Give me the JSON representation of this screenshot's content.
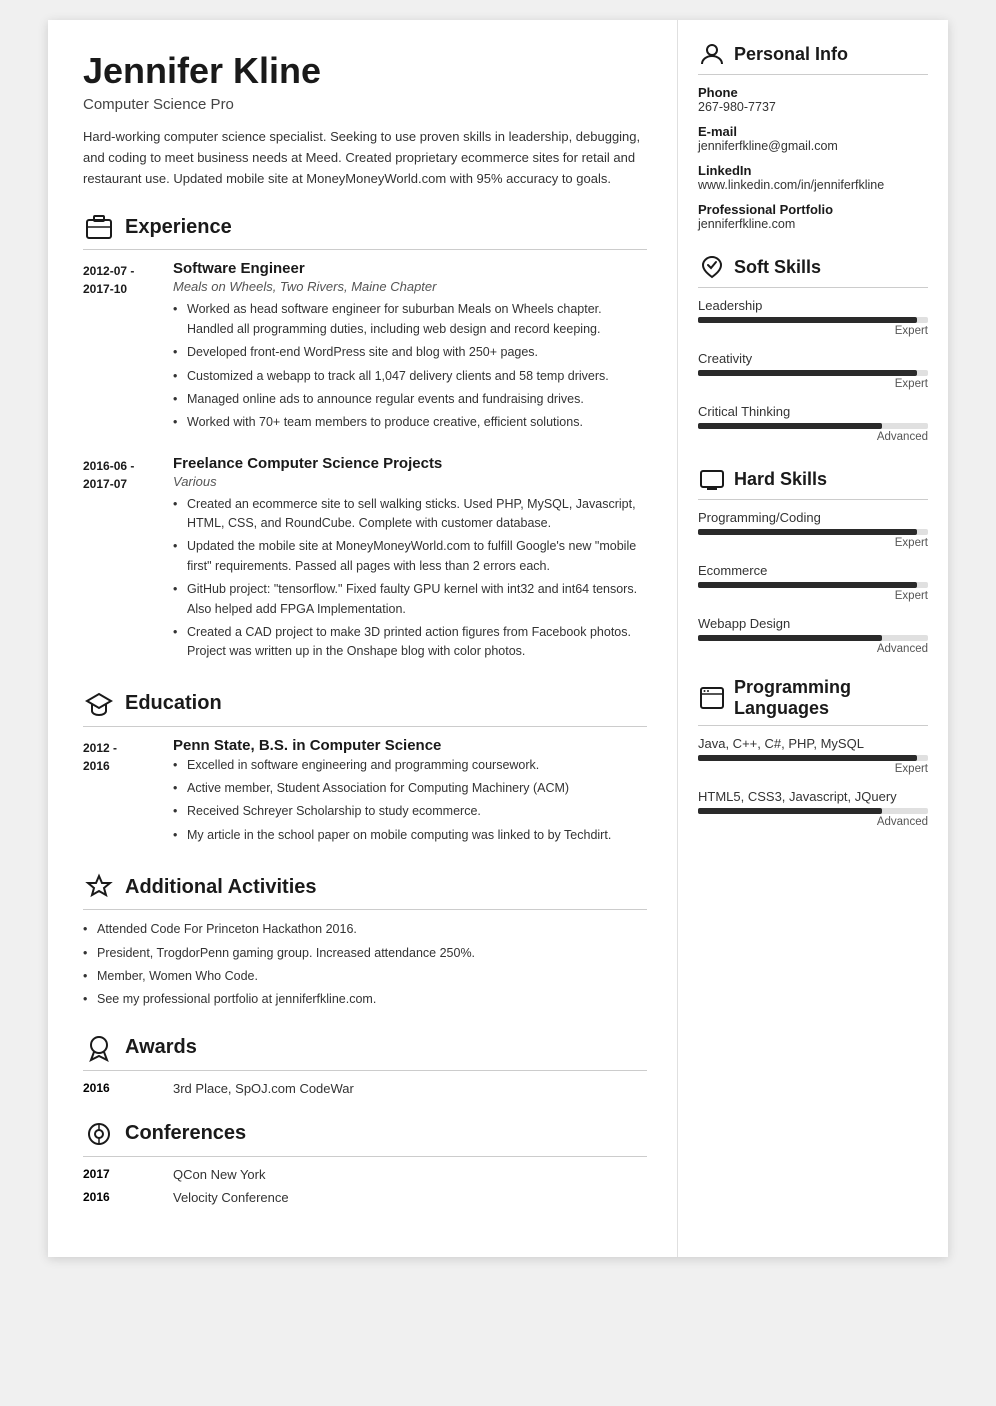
{
  "header": {
    "name": "Jennifer Kline",
    "title": "Computer Science Pro",
    "summary": "Hard-working computer science specialist. Seeking to use proven skills in leadership, debugging, and coding to meet business needs at Meed. Created proprietary ecommerce sites for retail and restaurant use. Updated mobile site at MoneyMoneyWorld.com with 95% accuracy to goals."
  },
  "sections": {
    "experience": {
      "title": "Experience",
      "entries": [
        {
          "date": "2012-07 -\n2017-10",
          "job_title": "Software Engineer",
          "company": "Meals on Wheels, Two Rivers, Maine Chapter",
          "bullets": [
            "Worked as head software engineer for suburban Meals on Wheels chapter. Handled all programming duties, including web design and record keeping.",
            "Developed front-end WordPress site and blog with 250+ pages.",
            "Customized a webapp to track all 1,047 delivery clients and 58 temp drivers.",
            "Managed online ads to announce regular events and fundraising drives.",
            "Worked with 70+ team members to produce creative, efficient solutions."
          ]
        },
        {
          "date": "2016-06 -\n2017-07",
          "job_title": "Freelance Computer Science Projects",
          "company": "Various",
          "bullets": [
            "Created an ecommerce site to sell walking sticks. Used PHP, MySQL, Javascript, HTML, CSS, and RoundCube. Complete with customer database.",
            "Updated the mobile site at MoneyMoneyWorld.com to fulfill Google's new \"mobile first\" requirements. Passed all pages with less than 2 errors each.",
            "GitHub project: \"tensorflow.\" Fixed faulty GPU kernel with int32 and int64 tensors. Also helped add FPGA Implementation.",
            "Created a CAD project to make 3D printed action figures from Facebook photos. Project was written up in the Onshape blog with color photos."
          ]
        }
      ]
    },
    "education": {
      "title": "Education",
      "entries": [
        {
          "date": "2012 -\n2016",
          "job_title": "Penn State, B.S. in Computer Science",
          "company": "",
          "bullets": [
            "Excelled in software engineering and programming coursework.",
            "Active member, Student Association for Computing Machinery (ACM)",
            "Received Schreyer Scholarship to study ecommerce.",
            "My article in the school paper on mobile computing was linked to by Techdirt."
          ]
        }
      ]
    },
    "additional_activities": {
      "title": "Additional Activities",
      "bullets": [
        "Attended Code For Princeton Hackathon 2016.",
        "President, TrogdorPenn gaming group. Increased attendance 250%.",
        "Member, Women Who Code.",
        "See my professional portfolio at jenniferfkline.com."
      ]
    },
    "awards": {
      "title": "Awards",
      "entries": [
        {
          "date": "2016",
          "text": "3rd Place, SpOJ.com CodeWar"
        }
      ]
    },
    "conferences": {
      "title": "Conferences",
      "entries": [
        {
          "date": "2017",
          "text": "QCon New York"
        },
        {
          "date": "2016",
          "text": "Velocity Conference"
        }
      ]
    }
  },
  "right": {
    "personal_info": {
      "title": "Personal Info",
      "items": [
        {
          "label": "Phone",
          "value": "267-980-7737"
        },
        {
          "label": "E-mail",
          "value": "jenniferfkline@gmail.com"
        },
        {
          "label": "LinkedIn",
          "value": "www.linkedin.com/in/jenniferfkline"
        },
        {
          "label": "Professional Portfolio",
          "value": "jenniferfkline.com"
        }
      ]
    },
    "soft_skills": {
      "title": "Soft Skills",
      "skills": [
        {
          "name": "Leadership",
          "level": "Expert",
          "pct": 95
        },
        {
          "name": "Creativity",
          "level": "Expert",
          "pct": 95
        },
        {
          "name": "Critical Thinking",
          "level": "Advanced",
          "pct": 80
        }
      ]
    },
    "hard_skills": {
      "title": "Hard Skills",
      "skills": [
        {
          "name": "Programming/Coding",
          "level": "Expert",
          "pct": 95
        },
        {
          "name": "Ecommerce",
          "level": "Expert",
          "pct": 95
        },
        {
          "name": "Webapp Design",
          "level": "Advanced",
          "pct": 80
        }
      ]
    },
    "programming_languages": {
      "title": "Programming Languages",
      "skills": [
        {
          "name": "Java, C++, C#, PHP, MySQL",
          "level": "Expert",
          "pct": 95
        },
        {
          "name": "HTML5, CSS3, Javascript, JQuery",
          "level": "Advanced",
          "pct": 80
        }
      ]
    }
  }
}
